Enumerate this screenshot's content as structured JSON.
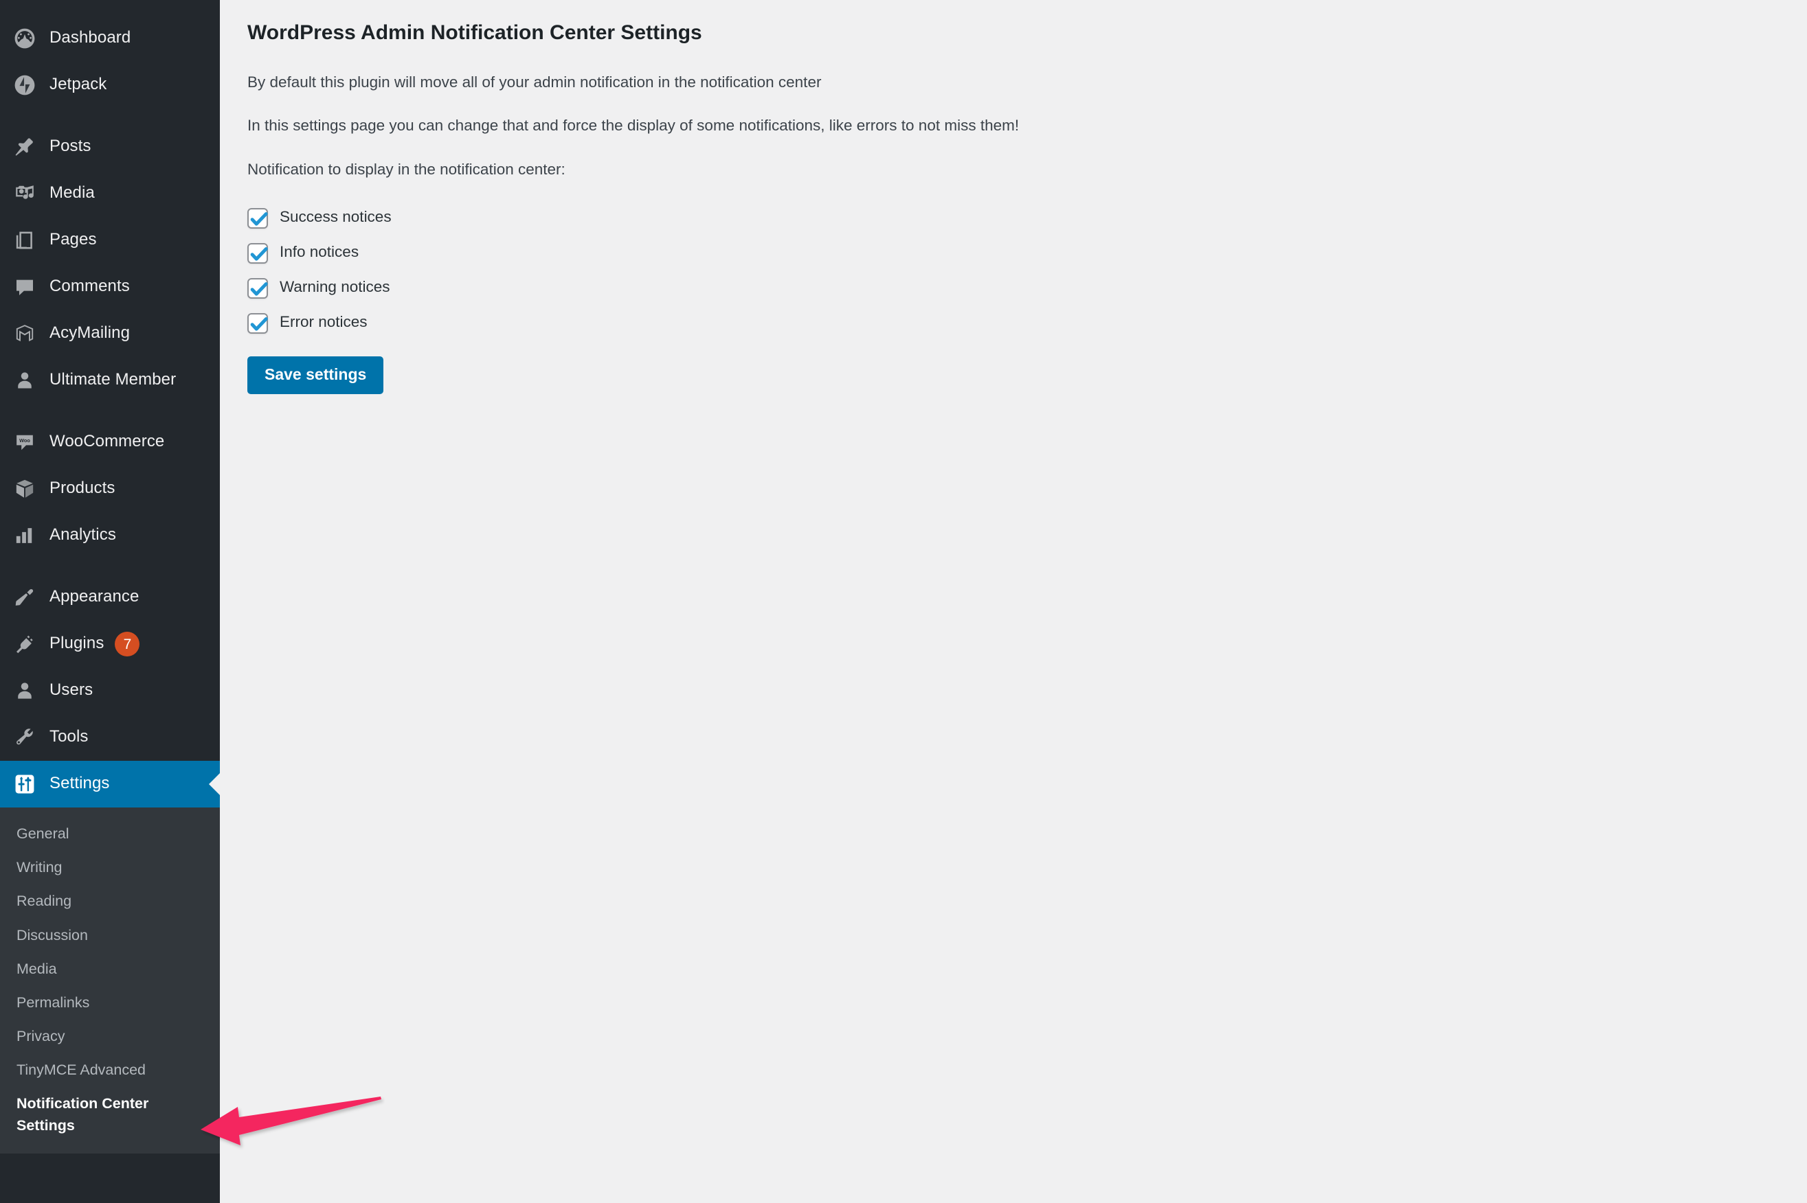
{
  "colors": {
    "sidebar_bg": "#23282d",
    "submenu_bg": "#32373c",
    "accent_blue": "#0073aa",
    "badge_orange": "#d54e21",
    "content_bg": "#f0f0f1",
    "arrow_pink": "#f4265f",
    "checkbox_check": "#2196d4"
  },
  "sidebar": {
    "items": [
      {
        "label": "Dashboard",
        "icon": "dashboard-icon"
      },
      {
        "label": "Jetpack",
        "icon": "jetpack-icon"
      },
      {
        "label": "Posts",
        "icon": "pin-icon"
      },
      {
        "label": "Media",
        "icon": "media-icon"
      },
      {
        "label": "Pages",
        "icon": "pages-icon"
      },
      {
        "label": "Comments",
        "icon": "comments-icon"
      },
      {
        "label": "AcyMailing",
        "icon": "acymailing-icon"
      },
      {
        "label": "Ultimate Member",
        "icon": "user-icon"
      },
      {
        "label": "WooCommerce",
        "icon": "woocommerce-icon"
      },
      {
        "label": "Products",
        "icon": "box-icon"
      },
      {
        "label": "Analytics",
        "icon": "bar-chart-icon"
      },
      {
        "label": "Appearance",
        "icon": "paintbrush-icon"
      },
      {
        "label": "Plugins",
        "icon": "plug-icon",
        "badge": "7"
      },
      {
        "label": "Users",
        "icon": "users-icon"
      },
      {
        "label": "Tools",
        "icon": "wrench-icon"
      },
      {
        "label": "Settings",
        "icon": "settings-sliders-icon",
        "current": true
      }
    ],
    "settings_submenu": [
      {
        "label": "General"
      },
      {
        "label": "Writing"
      },
      {
        "label": "Reading"
      },
      {
        "label": "Discussion"
      },
      {
        "label": "Media"
      },
      {
        "label": "Permalinks"
      },
      {
        "label": "Privacy"
      },
      {
        "label": "TinyMCE Advanced"
      },
      {
        "label": "Notification Center Settings",
        "current": true
      }
    ]
  },
  "main": {
    "title": "WordPress Admin Notification Center Settings",
    "intro_1": "By default this plugin will move all of your admin notification in the notification center",
    "intro_2": "In this settings page you can change that and force the display of some notifications, like errors to not miss them!",
    "list_label": "Notification to display in the notification center:",
    "checkboxes": [
      {
        "label": "Success notices",
        "checked": true
      },
      {
        "label": "Info notices",
        "checked": true
      },
      {
        "label": "Warning notices",
        "checked": true
      },
      {
        "label": "Error notices",
        "checked": true
      }
    ],
    "save_button": "Save settings"
  },
  "annotation": {
    "name": "arrow-pointing-to-notification-center-settings"
  }
}
